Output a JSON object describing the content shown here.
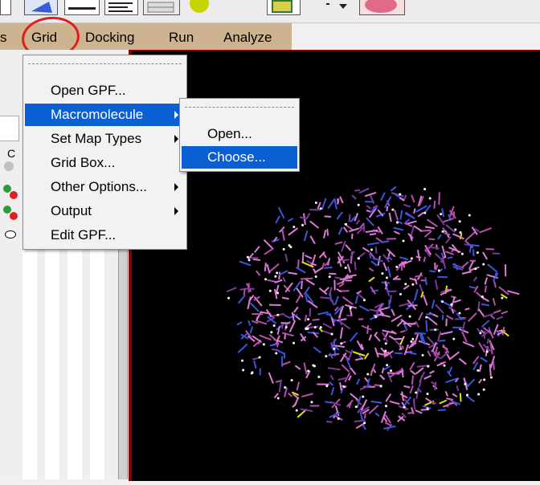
{
  "menubar": {
    "items": [
      {
        "label": "s"
      },
      {
        "label": "Grid"
      },
      {
        "label": "Docking"
      },
      {
        "label": "Run"
      },
      {
        "label": "Analyze"
      }
    ]
  },
  "left_panel": {
    "column_header": "C"
  },
  "grid_menu": {
    "items": [
      {
        "label": "Open GPF...",
        "has_submenu": false,
        "selected": false
      },
      {
        "label": "Macromolecule",
        "has_submenu": true,
        "selected": true
      },
      {
        "label": "Set Map Types",
        "has_submenu": true,
        "selected": false
      },
      {
        "label": "Grid Box...",
        "has_submenu": false,
        "selected": false
      },
      {
        "label": "Other Options...",
        "has_submenu": true,
        "selected": false
      },
      {
        "label": "Output",
        "has_submenu": true,
        "selected": false
      },
      {
        "label": "Edit GPF...",
        "has_submenu": false,
        "selected": false
      }
    ]
  },
  "macromolecule_submenu": {
    "items": [
      {
        "label": "Open...",
        "selected": false
      },
      {
        "label": "Choose...",
        "selected": true
      }
    ]
  },
  "colors": {
    "menubar_bg": "#cdb38f",
    "selection": "#0a5fd3",
    "viewer_bg": "#000000",
    "annotation": "#e31b1b",
    "molecule_pink": "#e07ad8",
    "molecule_blue": "#3a55e0"
  }
}
